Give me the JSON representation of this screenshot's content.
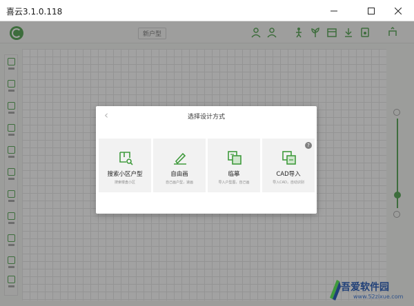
{
  "window": {
    "title": "喜云3.1.0.118",
    "controls": [
      "minimize-icon",
      "maximize-icon",
      "close-icon"
    ]
  },
  "toolbar": {
    "logo_icon": "app-logo-icon",
    "project_name": "新户型",
    "tool_icons": [
      "user-icon",
      "user-icon",
      "figure-icon",
      "plant-icon",
      "box-icon",
      "download-icon",
      "share-icon"
    ]
  },
  "sidebar": {
    "items": [
      "room-icon",
      "wall-icon",
      "door-icon",
      "window-icon",
      "structure-icon",
      "furniture-icon",
      "light-icon",
      "material-icon",
      "camera-icon",
      "search-icon",
      "more-icon"
    ]
  },
  "zoom": {
    "level": 0.15
  },
  "dialog": {
    "back_icon": "‹",
    "title": "选择设计方式",
    "options": [
      {
        "name": "搜索小区户型",
        "desc": "搜索楼盘小区",
        "icon": "search-plan-icon"
      },
      {
        "name": "自由画",
        "desc": "自己画户型，速画",
        "icon": "pen-draw-icon"
      },
      {
        "name": "临摹",
        "desc": "导入户型图，自己画",
        "icon": "trace-icon"
      },
      {
        "name": "CAD导入",
        "desc": "导入CAD，自动识别",
        "icon": "cad-import-icon"
      }
    ],
    "help": "?"
  },
  "watermark": {
    "brand": "吾爱软件园",
    "url": "www.52zixue.com"
  },
  "colors": {
    "accent": "#3f9a3c",
    "overlay": "rgba(60,60,60,0.48)",
    "card_bg": "#f2f2f2"
  }
}
